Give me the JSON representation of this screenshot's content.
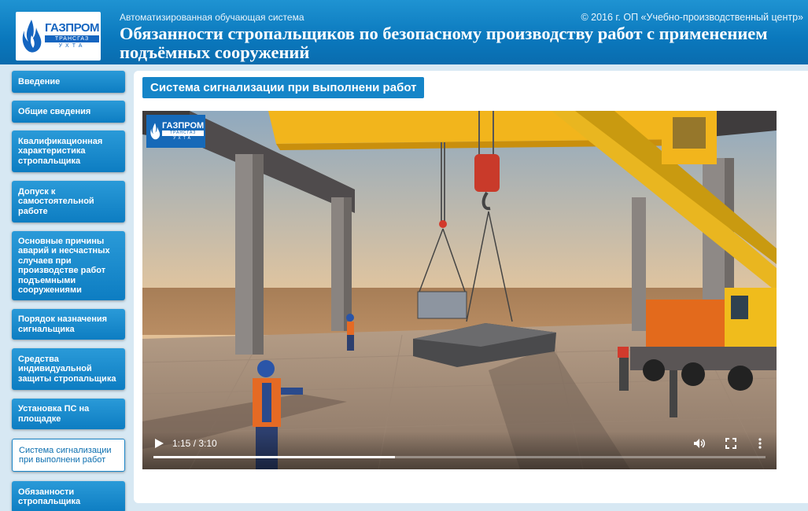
{
  "header": {
    "logo": {
      "name": "ГАЗПРОМ",
      "sub": "ТРАНСГАЗ",
      "city": "УХТА"
    },
    "subtitle": "Автоматизированная обучающая система",
    "copyright": "© 2016 г.  ОП «Учебно-производственный центр»",
    "title": "Обязанности стропальщиков по безопасному производству работ с применением подъёмных сооружений"
  },
  "sidebar": {
    "items": [
      {
        "label": "Введение"
      },
      {
        "label": "Общие сведения"
      },
      {
        "label": "Квалификационная характеристика стропальщика"
      },
      {
        "label": "Допуск к самостоятельной работе"
      },
      {
        "label": "Основные причины аварий и несчастных случаев при производстве работ подъемными сооружениями"
      },
      {
        "label": "Порядок назначения сигнальщика"
      },
      {
        "label": "Средства индивидуальной защиты стропальщика"
      },
      {
        "label": "Установка ПС на площадке"
      },
      {
        "label": "Система сигнализации при выполнени работ",
        "active": true
      },
      {
        "label": "Обязанности стропальщика"
      }
    ]
  },
  "main": {
    "section_title": "Система сигнализации при выполнени работ",
    "video": {
      "time": "1:15 / 3:10",
      "progress": 0.395,
      "controls": {
        "play": "play-icon",
        "volume": "volume-icon",
        "fullscreen": "fullscreen-icon",
        "more": "more-options-icon"
      }
    }
  },
  "colors": {
    "header_blue": "#0a78bd",
    "nav_blue": "#1585c8",
    "crane_yellow": "#f2b51c",
    "background": "#d7e8f3"
  }
}
